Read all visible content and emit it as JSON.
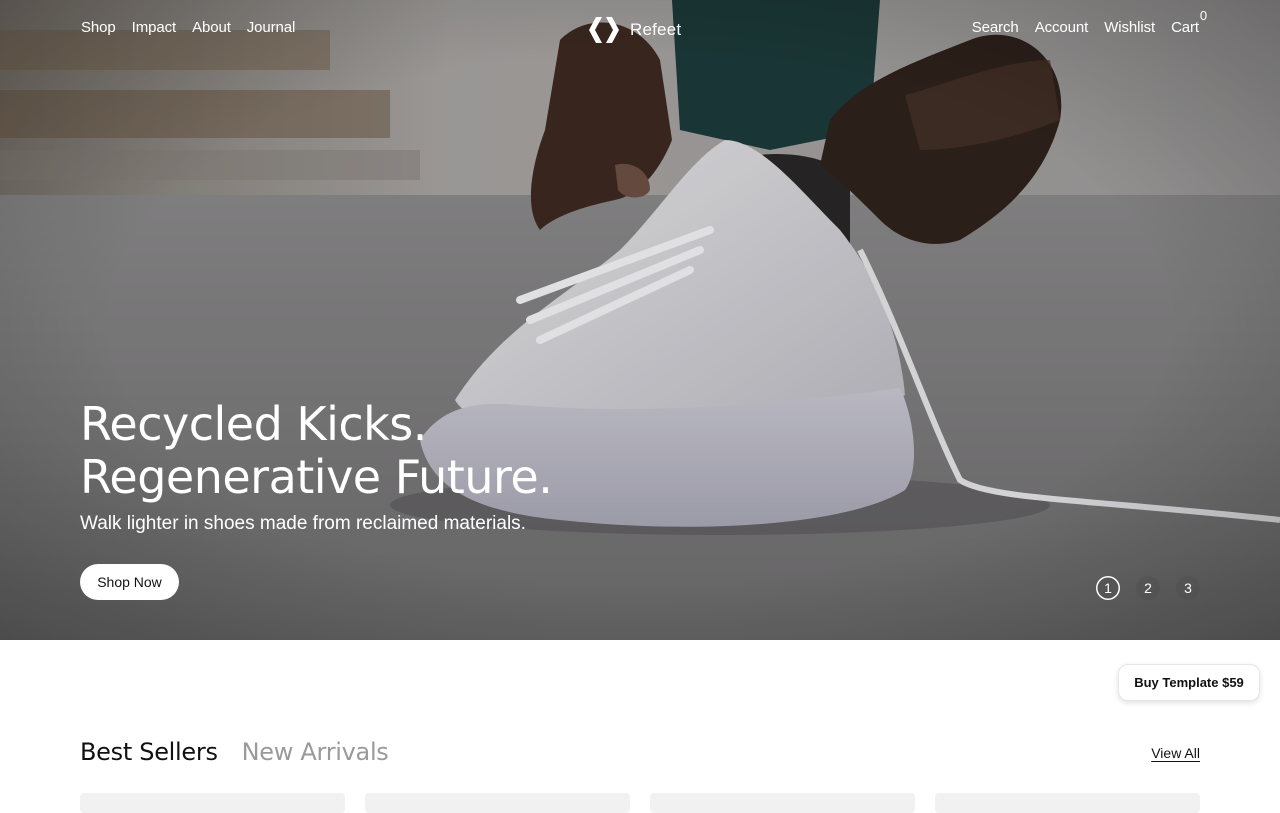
{
  "nav": {
    "left": [
      "Shop",
      "Impact",
      "About",
      "Journal"
    ],
    "right": [
      "Search",
      "Account",
      "Wishlist"
    ],
    "cart_label": "Cart",
    "cart_count": "0"
  },
  "brand": {
    "name": "Refeet",
    "logo_icon": "chevron-pair-logo"
  },
  "hero": {
    "title_line1": "Recycled Kicks.",
    "title_line2": "Regenerative Future.",
    "subtitle": "Walk lighter in shoes made from reclaimed materials.",
    "cta": "Shop Now",
    "slides": [
      "1",
      "2",
      "3"
    ],
    "active_slide": "1"
  },
  "buy_template": "Buy Template $59",
  "products": {
    "tabs": [
      "Best Sellers",
      "New Arrivals"
    ],
    "active_tab": "Best Sellers",
    "view_all": "View All"
  },
  "colors": {
    "text": "#111111",
    "muted": "#9a9a9a",
    "white": "#ffffff"
  }
}
